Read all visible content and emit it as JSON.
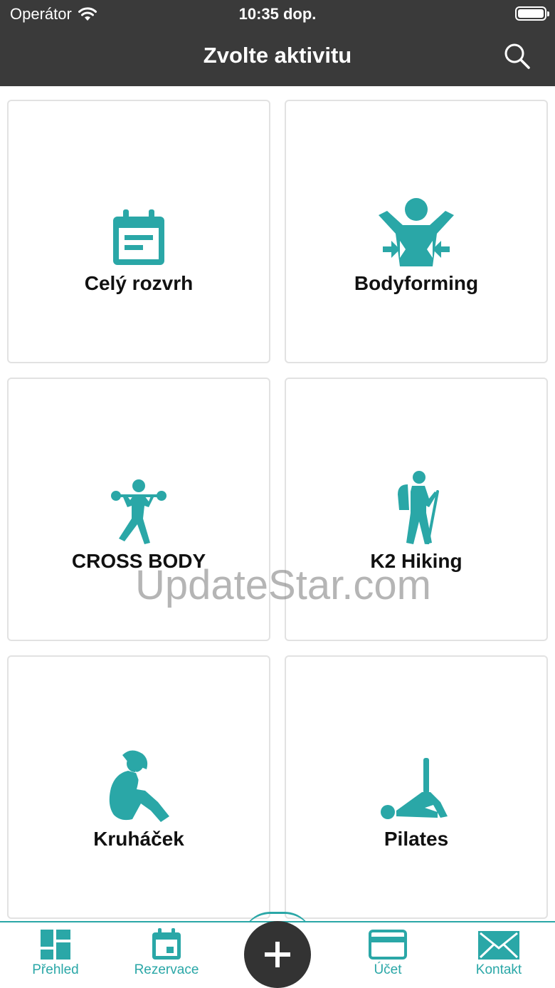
{
  "status": {
    "carrier": "Operátor",
    "time": "10:35 dop."
  },
  "header": {
    "title": "Zvolte aktivitu"
  },
  "activities": [
    {
      "label": "Celý rozvrh",
      "icon": "calendar-icon"
    },
    {
      "label": "Bodyforming",
      "icon": "bodyforming-icon"
    },
    {
      "label": "CROSS BODY",
      "icon": "weightlifting-icon"
    },
    {
      "label": "K2 Hiking",
      "icon": "hiking-icon"
    },
    {
      "label": "Kruháček",
      "icon": "situp-icon"
    },
    {
      "label": "Pilates",
      "icon": "pilates-icon"
    }
  ],
  "watermark": "UpdateStar.com",
  "tabs": [
    {
      "label": "Přehled",
      "icon": "dashboard-icon"
    },
    {
      "label": "Rezervace",
      "icon": "calendar-icon"
    },
    {
      "label": "",
      "icon": "plus-icon"
    },
    {
      "label": "Účet",
      "icon": "card-icon"
    },
    {
      "label": "Kontakt",
      "icon": "envelope-icon"
    }
  ],
  "colors": {
    "accent": "#2aa7a7",
    "header_bg": "#3a3a3a",
    "fab_bg": "#333333"
  }
}
